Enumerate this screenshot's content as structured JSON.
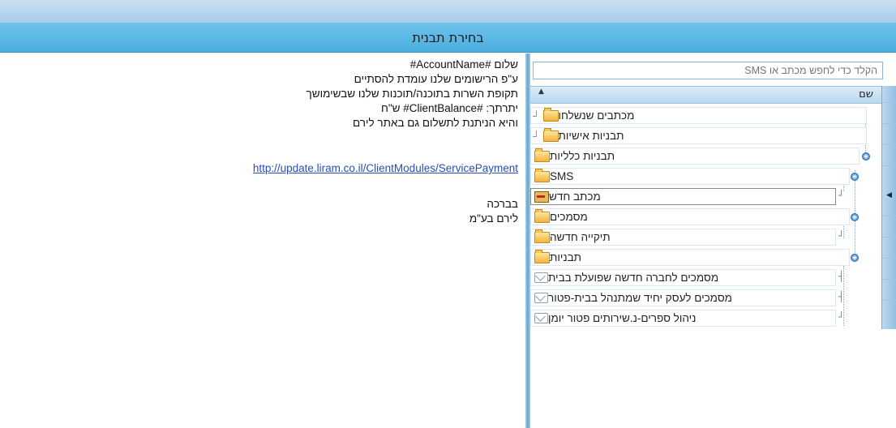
{
  "dialog": {
    "title": "בחירת תבנית"
  },
  "preview": {
    "lines": [
      "שלום #AccountName#",
      "ע\"פ הרישומים שלנו עומדת להסתיים",
      "תקופת השרות בתוכנה/תוכנות שלנו שבשימושך",
      "יתרתך: #ClientBalance# ש\"ח",
      "והיא הניתנת לתשלום גם באתר לירם"
    ],
    "link": "http://update.liram.co.il/ClientModules/ServicePayment",
    "closing": [
      "בברכה",
      "לירם בע\"מ"
    ]
  },
  "search": {
    "placeholder": "הקלד כדי לחפש מכתב או SMS"
  },
  "tree": {
    "column_header": "שם",
    "items": [
      {
        "label": "מכתבים שנשלחו",
        "icon": "folder-icon"
      },
      {
        "label": "תבניות אישיות",
        "icon": "folder-icon"
      },
      {
        "label": "תבניות כלליות",
        "icon": "folder-icon",
        "expanded": true
      },
      {
        "label": "SMS",
        "icon": "folder-icon",
        "expanded": true
      },
      {
        "label": "מכתב חדש",
        "icon": "document-icon",
        "selected": true
      },
      {
        "label": "מסמכים",
        "icon": "folder-icon",
        "expanded": true
      },
      {
        "label": "תיקייה חדשה",
        "icon": "folder-icon"
      },
      {
        "label": "תבניות",
        "icon": "folder-icon",
        "expanded": true
      },
      {
        "label": "מסמכים לחברה חדשה שפועלת בבית",
        "icon": "template-icon"
      },
      {
        "label": "מסמכים לעסק יחיד שמתנהל בבית-פטור",
        "icon": "template-icon"
      },
      {
        "label": "ניהול ספרים-נ.שירותים פטור יומן",
        "icon": "template-icon"
      }
    ]
  },
  "colors": {
    "title_bar": "#4aaede",
    "link": "#2a4fb3",
    "folder": "#f4b33c"
  }
}
